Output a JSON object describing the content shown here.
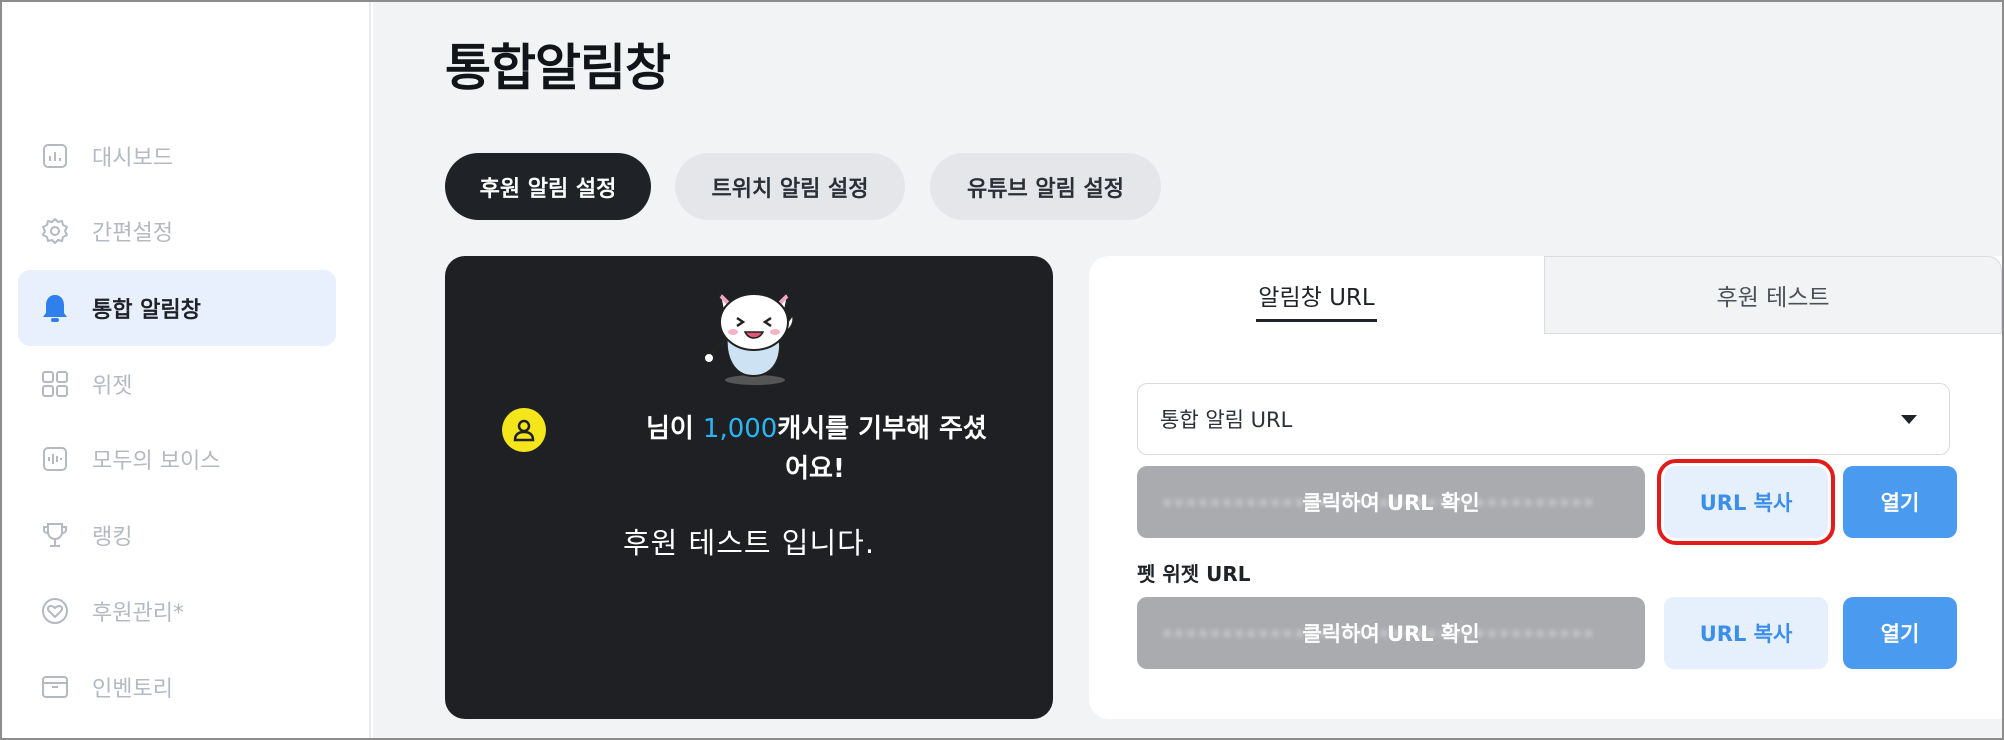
{
  "page": {
    "title": "통합알림창"
  },
  "sidebar": {
    "items": [
      {
        "label": "대시보드",
        "icon": "dashboard-icon",
        "active": false
      },
      {
        "label": "간편설정",
        "icon": "gear-icon",
        "active": false
      },
      {
        "label": "통합 알림창",
        "icon": "bell-icon",
        "active": true
      },
      {
        "label": "위젯",
        "icon": "grid-icon",
        "active": false
      },
      {
        "label": "모두의 보이스",
        "icon": "audio-wave-icon",
        "active": false
      },
      {
        "label": "랭킹",
        "icon": "trophy-icon",
        "active": false
      },
      {
        "label": "후원관리*",
        "icon": "heart-icon",
        "active": false
      },
      {
        "label": "인벤토리",
        "icon": "inventory-box-icon",
        "active": false
      }
    ]
  },
  "tabs": [
    {
      "label": "후원 알림 설정",
      "active": true
    },
    {
      "label": "트위치 알림 설정",
      "active": false
    },
    {
      "label": "유튜브 알림 설정",
      "active": false
    }
  ],
  "preview": {
    "alert_prefix": "님이 ",
    "alert_amount": "1,000",
    "alert_suffix": "캐시를 기부해 주셨",
    "alert_line2": "어요!",
    "test_message": "후원 테스트 입니다.",
    "amount_color": "#29b6f6",
    "badge_color": "#f5e61c"
  },
  "panel": {
    "tabs": [
      {
        "label": "알림창 URL",
        "active": true
      },
      {
        "label": "후원 테스트",
        "active": false
      }
    ],
    "select_value": "통합 알림 URL",
    "rows": [
      {
        "section_label": "",
        "reveal_label": "클릭하여 URL 확인",
        "copy_label": "URL 복사",
        "open_label": "열기",
        "highlighted": true
      },
      {
        "section_label": "펫 위젯 URL",
        "reveal_label": "클릭하여 URL 확인",
        "copy_label": "URL 복사",
        "open_label": "열기",
        "highlighted": false
      }
    ]
  },
  "colors": {
    "accent": "#4a9af0",
    "highlight_outline": "#e21c1c",
    "active_nav_bg": "#e8f0fe",
    "dark": "#1f2328"
  }
}
